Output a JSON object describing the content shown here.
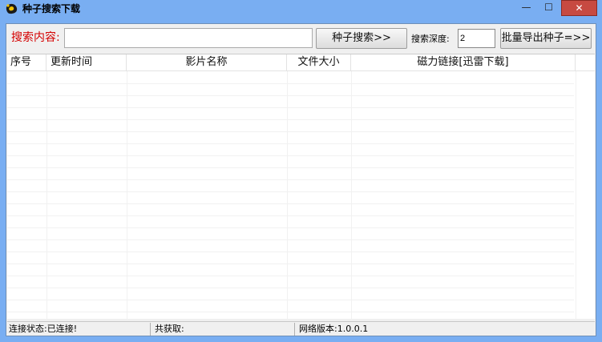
{
  "window": {
    "title": "种子搜索下载",
    "min_glyph": "—",
    "max_glyph": "☐",
    "close_glyph": "✕"
  },
  "toolbar": {
    "search_label": "搜索内容:",
    "search_value": "",
    "search_button": "种子搜索>>",
    "depth_label": "搜索深度:",
    "depth_value": "2",
    "export_button": "批量导出种子=>>"
  },
  "table": {
    "columns": [
      "序号",
      "更新时间",
      "影片名称",
      "文件大小",
      "磁力链接[迅雷下载]"
    ],
    "rows": []
  },
  "status": {
    "connection": "连接状态:已连接!",
    "total": "共获取:",
    "version": "网络版本:1.0.0.1"
  },
  "colors": {
    "title_bg": "#79aef2",
    "close_bg": "#c74a41",
    "label_red": "#d40000"
  }
}
